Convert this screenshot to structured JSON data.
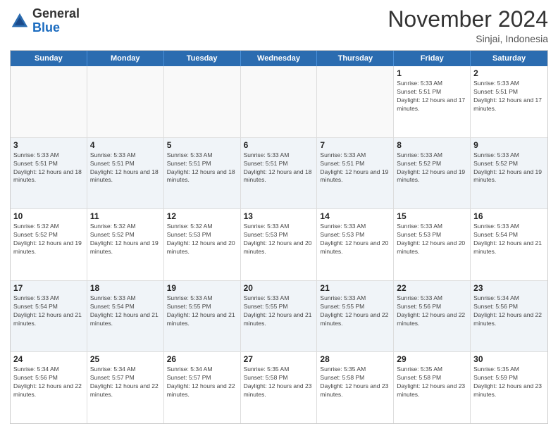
{
  "header": {
    "logo": {
      "line1": "General",
      "line2": "Blue"
    },
    "month": "November 2024",
    "location": "Sinjai, Indonesia"
  },
  "days_of_week": [
    "Sunday",
    "Monday",
    "Tuesday",
    "Wednesday",
    "Thursday",
    "Friday",
    "Saturday"
  ],
  "weeks": [
    [
      {
        "day": "",
        "empty": true
      },
      {
        "day": "",
        "empty": true
      },
      {
        "day": "",
        "empty": true
      },
      {
        "day": "",
        "empty": true
      },
      {
        "day": "",
        "empty": true
      },
      {
        "day": "1",
        "sunrise": "5:33 AM",
        "sunset": "5:51 PM",
        "daylight": "12 hours and 17 minutes."
      },
      {
        "day": "2",
        "sunrise": "5:33 AM",
        "sunset": "5:51 PM",
        "daylight": "12 hours and 17 minutes."
      }
    ],
    [
      {
        "day": "3",
        "sunrise": "5:33 AM",
        "sunset": "5:51 PM",
        "daylight": "12 hours and 18 minutes."
      },
      {
        "day": "4",
        "sunrise": "5:33 AM",
        "sunset": "5:51 PM",
        "daylight": "12 hours and 18 minutes."
      },
      {
        "day": "5",
        "sunrise": "5:33 AM",
        "sunset": "5:51 PM",
        "daylight": "12 hours and 18 minutes."
      },
      {
        "day": "6",
        "sunrise": "5:33 AM",
        "sunset": "5:51 PM",
        "daylight": "12 hours and 18 minutes."
      },
      {
        "day": "7",
        "sunrise": "5:33 AM",
        "sunset": "5:51 PM",
        "daylight": "12 hours and 19 minutes."
      },
      {
        "day": "8",
        "sunrise": "5:33 AM",
        "sunset": "5:52 PM",
        "daylight": "12 hours and 19 minutes."
      },
      {
        "day": "9",
        "sunrise": "5:33 AM",
        "sunset": "5:52 PM",
        "daylight": "12 hours and 19 minutes."
      }
    ],
    [
      {
        "day": "10",
        "sunrise": "5:32 AM",
        "sunset": "5:52 PM",
        "daylight": "12 hours and 19 minutes."
      },
      {
        "day": "11",
        "sunrise": "5:32 AM",
        "sunset": "5:52 PM",
        "daylight": "12 hours and 19 minutes."
      },
      {
        "day": "12",
        "sunrise": "5:32 AM",
        "sunset": "5:53 PM",
        "daylight": "12 hours and 20 minutes."
      },
      {
        "day": "13",
        "sunrise": "5:33 AM",
        "sunset": "5:53 PM",
        "daylight": "12 hours and 20 minutes."
      },
      {
        "day": "14",
        "sunrise": "5:33 AM",
        "sunset": "5:53 PM",
        "daylight": "12 hours and 20 minutes."
      },
      {
        "day": "15",
        "sunrise": "5:33 AM",
        "sunset": "5:53 PM",
        "daylight": "12 hours and 20 minutes."
      },
      {
        "day": "16",
        "sunrise": "5:33 AM",
        "sunset": "5:54 PM",
        "daylight": "12 hours and 21 minutes."
      }
    ],
    [
      {
        "day": "17",
        "sunrise": "5:33 AM",
        "sunset": "5:54 PM",
        "daylight": "12 hours and 21 minutes."
      },
      {
        "day": "18",
        "sunrise": "5:33 AM",
        "sunset": "5:54 PM",
        "daylight": "12 hours and 21 minutes."
      },
      {
        "day": "19",
        "sunrise": "5:33 AM",
        "sunset": "5:55 PM",
        "daylight": "12 hours and 21 minutes."
      },
      {
        "day": "20",
        "sunrise": "5:33 AM",
        "sunset": "5:55 PM",
        "daylight": "12 hours and 21 minutes."
      },
      {
        "day": "21",
        "sunrise": "5:33 AM",
        "sunset": "5:55 PM",
        "daylight": "12 hours and 22 minutes."
      },
      {
        "day": "22",
        "sunrise": "5:33 AM",
        "sunset": "5:56 PM",
        "daylight": "12 hours and 22 minutes."
      },
      {
        "day": "23",
        "sunrise": "5:34 AM",
        "sunset": "5:56 PM",
        "daylight": "12 hours and 22 minutes."
      }
    ],
    [
      {
        "day": "24",
        "sunrise": "5:34 AM",
        "sunset": "5:56 PM",
        "daylight": "12 hours and 22 minutes."
      },
      {
        "day": "25",
        "sunrise": "5:34 AM",
        "sunset": "5:57 PM",
        "daylight": "12 hours and 22 minutes."
      },
      {
        "day": "26",
        "sunrise": "5:34 AM",
        "sunset": "5:57 PM",
        "daylight": "12 hours and 22 minutes."
      },
      {
        "day": "27",
        "sunrise": "5:35 AM",
        "sunset": "5:58 PM",
        "daylight": "12 hours and 23 minutes."
      },
      {
        "day": "28",
        "sunrise": "5:35 AM",
        "sunset": "5:58 PM",
        "daylight": "12 hours and 23 minutes."
      },
      {
        "day": "29",
        "sunrise": "5:35 AM",
        "sunset": "5:58 PM",
        "daylight": "12 hours and 23 minutes."
      },
      {
        "day": "30",
        "sunrise": "5:35 AM",
        "sunset": "5:59 PM",
        "daylight": "12 hours and 23 minutes."
      }
    ]
  ]
}
